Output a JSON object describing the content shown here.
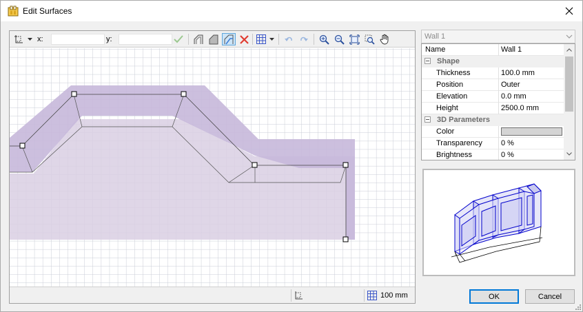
{
  "window": {
    "title": "Edit Surfaces",
    "close_icon": "close-icon"
  },
  "toolbar": {
    "x_label": "x:",
    "x_value": "",
    "y_label": "y:",
    "y_value": "",
    "icons": [
      "coordinate-origin-icon",
      "dropdown-arrow-icon",
      "accept-check-icon",
      "surface-tool-1-icon",
      "surface-tool-2-icon",
      "surface-tool-3-icon",
      "delete-icon",
      "grid-icon",
      "undo-icon",
      "redo-icon",
      "zoom-in-icon",
      "zoom-out-icon",
      "zoom-extents-icon",
      "zoom-window-icon",
      "pan-hand-icon"
    ]
  },
  "statusbar": {
    "grid_size": "100 mm"
  },
  "selector": {
    "value": "Wall 1"
  },
  "properties": {
    "name_label": "Name",
    "name_value": "Wall 1",
    "shape_category": "Shape",
    "thickness_label": "Thickness",
    "thickness_value": "100.0 mm",
    "position_label": "Position",
    "position_value": "Outer",
    "elevation_label": "Elevation",
    "elevation_value": "0.0 mm",
    "height_label": "Height",
    "height_value": "2500.0 mm",
    "params_category": "3D Parameters",
    "color_label": "Color",
    "color_value": "#d4d4d4",
    "transparency_label": "Transparency",
    "transparency_value": "0 %",
    "brightness_label": "Brightness",
    "brightness_value": "0 %"
  },
  "buttons": {
    "ok": "OK",
    "cancel": "Cancel"
  },
  "colors": {
    "surface_fill": "#d9cfe3",
    "wall_fill": "#c7b8da",
    "accent": "#0078d7",
    "preview_stroke": "#0000cc"
  }
}
